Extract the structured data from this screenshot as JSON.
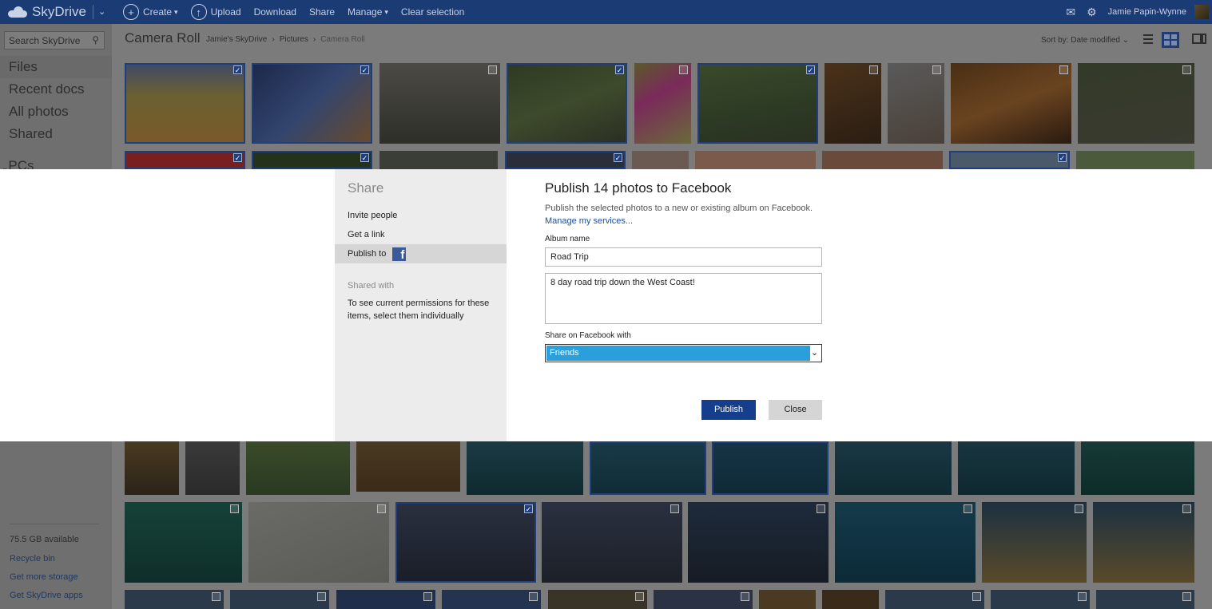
{
  "topbar": {
    "app_name": "SkyDrive",
    "create": "Create",
    "upload": "Upload",
    "download": "Download",
    "share": "Share",
    "manage": "Manage",
    "clear_selection": "Clear selection",
    "user_name": "Jamie Papin-Wynne"
  },
  "sidebar": {
    "search_placeholder": "Search SkyDrive",
    "items": [
      {
        "label": "Files",
        "active": true
      },
      {
        "label": "Recent docs",
        "active": false
      },
      {
        "label": "All photos",
        "active": false
      },
      {
        "label": "Shared",
        "active": false
      }
    ],
    "pcs_label": "PCs",
    "storage": "75.5 GB available",
    "recycle_bin": "Recycle bin",
    "more_storage": "Get more storage",
    "apps": "Get SkyDrive apps"
  },
  "header": {
    "title": "Camera Roll",
    "breadcrumb": [
      "Jamie's SkyDrive",
      "Pictures",
      "Camera Roll"
    ],
    "sort": "Sort by: Date modified"
  },
  "dialog": {
    "share_title": "Share",
    "options": [
      "Invite people",
      "Get a link",
      "Publish to"
    ],
    "active_option": "Publish to",
    "shared_with_label": "Shared with",
    "shared_with_note": "To see current permissions for these items, select them individually",
    "title": "Publish 14 photos to Facebook",
    "description": "Publish the selected photos to a new or existing album on Facebook.",
    "manage_link": "Manage my services...",
    "album_label": "Album name",
    "album_value": "Road Trip",
    "caption_value": "8 day road trip down the West Coast!",
    "audience_label": "Share on Facebook with",
    "audience_value": "Friends",
    "publish_button": "Publish",
    "close_button": "Close"
  },
  "colors": {
    "topbar": "#1a3b73",
    "accent": "#153f8c",
    "facebook": "#3b5998",
    "select_highlight": "#2a9fdc"
  }
}
